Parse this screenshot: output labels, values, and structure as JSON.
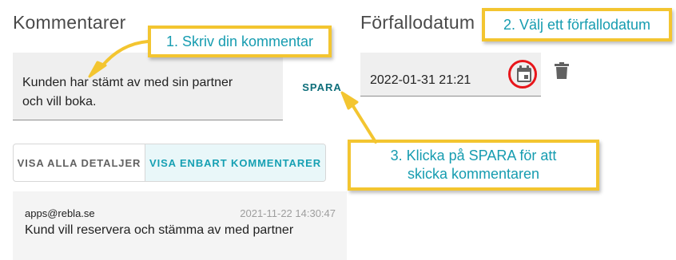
{
  "comments_section": {
    "title": "Kommentarer",
    "comment_input_value": "Kunden har stämt av med sin partner\noch vill boka.",
    "save_label": "SPARA"
  },
  "due_date_section": {
    "title": "Förfallodatum",
    "date_value": "2022-01-31 21:21",
    "calendar_icon": "calendar-icon",
    "delete_icon": "trash-icon"
  },
  "view_toggle": {
    "show_all_details": "VISA ALLA DETALJER",
    "show_only_comments": "VISA ENBART KOMMENTARER",
    "selected": "show_only_comments"
  },
  "comment_list": [
    {
      "author": "apps@rebla.se",
      "timestamp": "2021-11-22 14:30:47",
      "text": "Kund vill reservera och stämma av med partner"
    }
  ],
  "annotations": {
    "step1": "1. Skriv din kommentar",
    "step2": "2. Välj ett förfallodatum",
    "step3": "3. Klicka på SPARA för att\nskicka kommentaren"
  },
  "colors": {
    "accent": "#16a0b3",
    "callout_border": "#f3c530",
    "highlight_ring": "#e8161b",
    "save_text": "#0d6e7a"
  }
}
